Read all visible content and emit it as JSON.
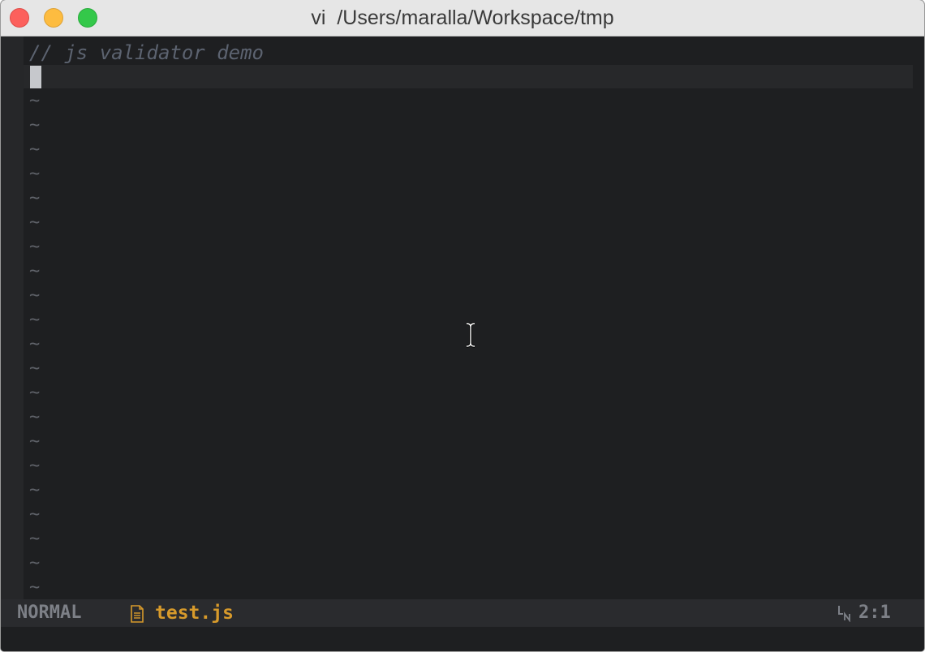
{
  "window": {
    "title": "vi  /Users/maralla/Workspace/tmp"
  },
  "editor": {
    "lines": [
      "// js validator demo",
      ""
    ],
    "empty_line_marker": "~",
    "empty_line_count": 21
  },
  "statusline": {
    "mode": "NORMAL",
    "file_icon": "file-icon",
    "filename": "test.js",
    "line_icon": "line-number-icon",
    "position": "2:1"
  },
  "colors": {
    "background": "#1e1f21",
    "comment": "#5c6370",
    "filename": "#d79a2b",
    "statusline": "#2a2b2e"
  }
}
